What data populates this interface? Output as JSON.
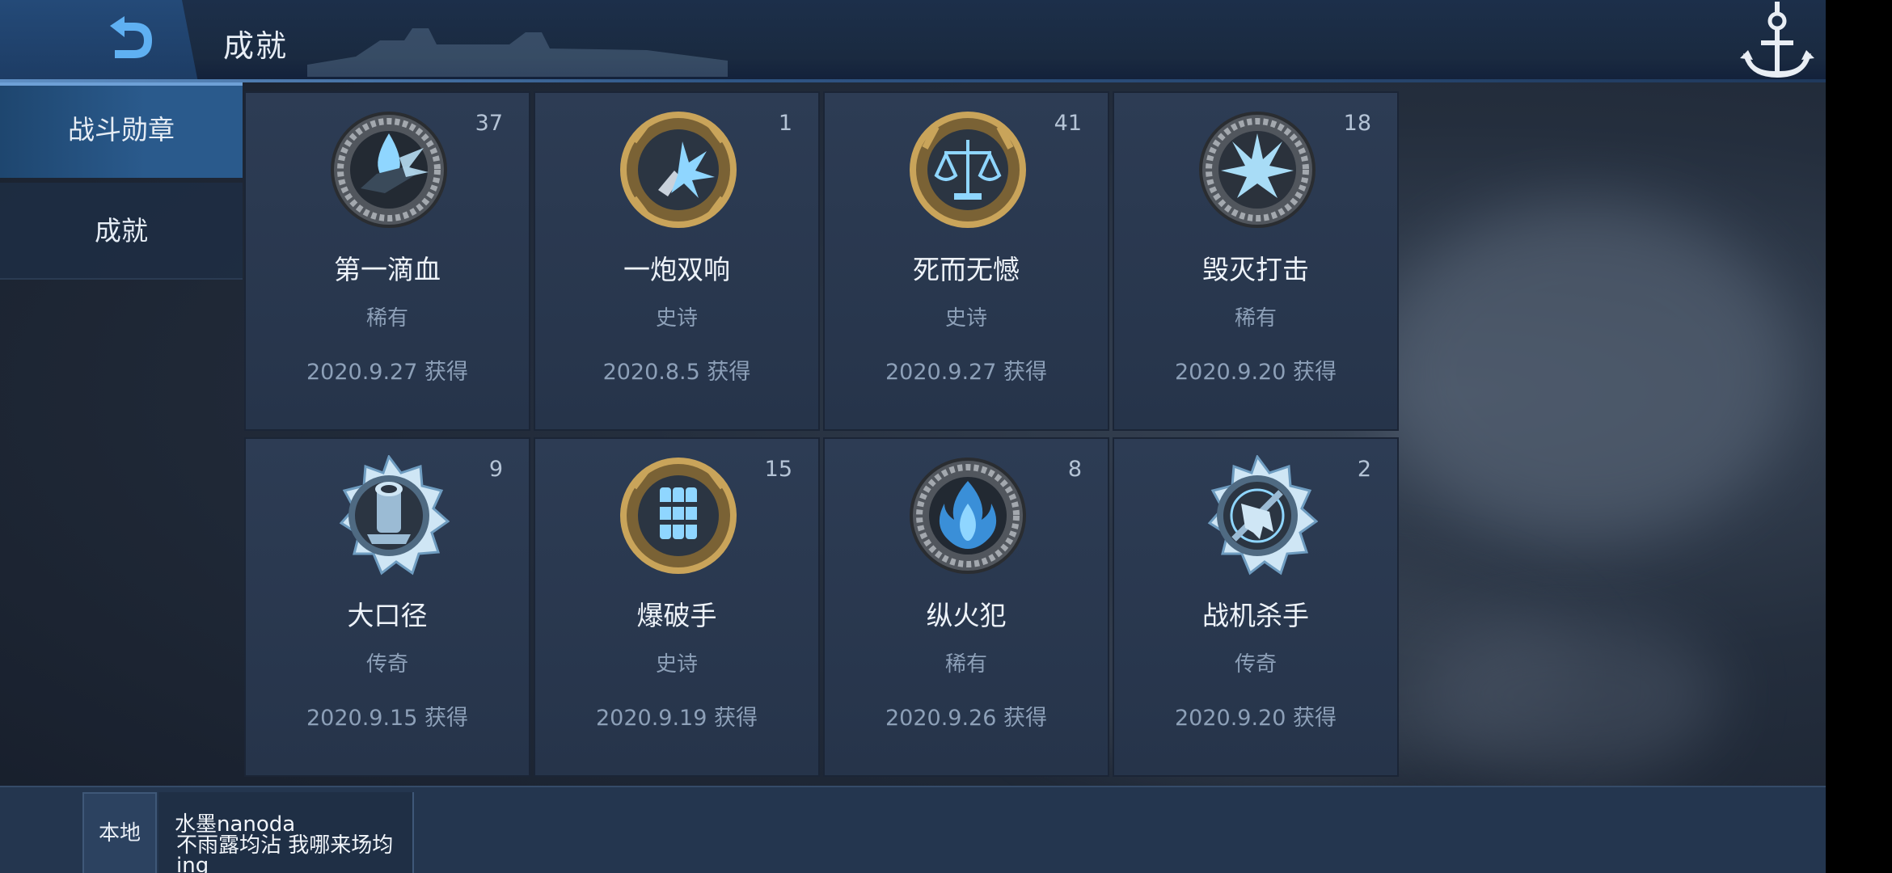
{
  "header": {
    "title": "成就"
  },
  "sidebar": {
    "items": [
      {
        "label": "战斗勋章",
        "active": true
      },
      {
        "label": "成就",
        "active": false
      }
    ]
  },
  "medals": [
    {
      "count": "37",
      "name": "第一滴血",
      "rarity": "稀有",
      "date": "2020.9.27  获得",
      "frame": "silver",
      "motif": "drop"
    },
    {
      "count": "1",
      "name": "一炮双响",
      "rarity": "史诗",
      "date": "2020.8.5   获得",
      "frame": "gold",
      "motif": "blast"
    },
    {
      "count": "41",
      "name": "死而无憾",
      "rarity": "史诗",
      "date": "2020.9.27  获得",
      "frame": "gold",
      "motif": "scale"
    },
    {
      "count": "18",
      "name": "毁灭打击",
      "rarity": "稀有",
      "date": "2020.9.20  获得",
      "frame": "silver",
      "motif": "burst"
    },
    {
      "count": "9",
      "name": "大口径",
      "rarity": "传奇",
      "date": "2020.9.15  获得",
      "frame": "star",
      "motif": "cannon"
    },
    {
      "count": "15",
      "name": "爆破手",
      "rarity": "史诗",
      "date": "2020.9.19  获得",
      "frame": "gold",
      "motif": "dynamite"
    },
    {
      "count": "8",
      "name": "纵火犯",
      "rarity": "稀有",
      "date": "2020.9.26  获得",
      "frame": "silver",
      "motif": "flame"
    },
    {
      "count": "2",
      "name": "战机杀手",
      "rarity": "传奇",
      "date": "2020.9.20  获得",
      "frame": "star",
      "motif": "plane"
    }
  ],
  "chat": {
    "channel": "本地",
    "sender": "水墨nanoda",
    "message": "不雨露均沾 我哪来场均ing"
  },
  "colors": {
    "accent": "#2a5a8c",
    "card": "#2d3c54",
    "gold": "#c9a45a",
    "silver": "#8f959c",
    "ice": "#8fd6ff"
  },
  "icons": {
    "back": "back-arrow-icon",
    "anchor": "anchor-icon"
  }
}
